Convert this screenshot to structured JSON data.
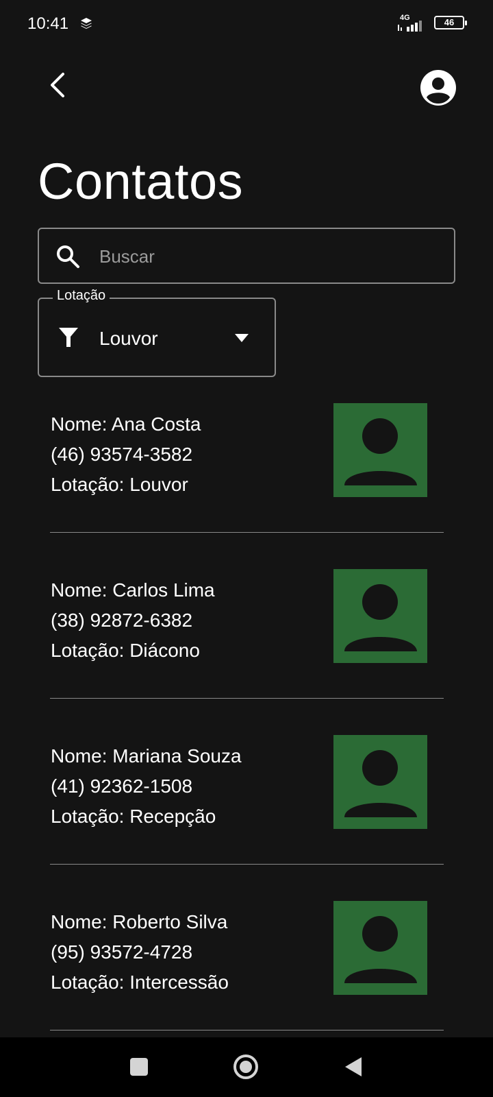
{
  "status_bar": {
    "time": "10:41",
    "network": "4G",
    "battery": "46",
    "layers_icon": "layers-icon",
    "signal_icon": "signal-bars-icon"
  },
  "header": {
    "back_icon": "chevron-left-icon",
    "profile_icon": "account-circle-icon"
  },
  "title": "Contatos",
  "search": {
    "placeholder": "Buscar",
    "value": "",
    "icon": "search-icon"
  },
  "filter": {
    "label": "Lotação",
    "value": "Louvor",
    "icon": "funnel-icon",
    "dropdown_icon": "caret-down-icon"
  },
  "contacts": [
    {
      "name": "Nome: Ana Costa",
      "phone": "(46) 93574-3582",
      "lotacao": "Lotação: Louvor"
    },
    {
      "name": "Nome: Carlos Lima",
      "phone": "(38) 92872-6382",
      "lotacao": "Lotação: Diácono"
    },
    {
      "name": "Nome: Mariana Souza",
      "phone": "(41) 92362-1508",
      "lotacao": "Lotação: Recepção"
    },
    {
      "name": "Nome: Roberto Silva",
      "phone": "(95) 93572-4728",
      "lotacao": "Lotação: Intercessão"
    }
  ],
  "colors": {
    "background": "#141414",
    "avatar_bg": "#2b6b35",
    "outline": "#8a8a8a"
  },
  "nav_bar": {
    "recents_icon": "square-icon",
    "home_icon": "circle-home-icon",
    "back_icon": "triangle-back-icon"
  }
}
